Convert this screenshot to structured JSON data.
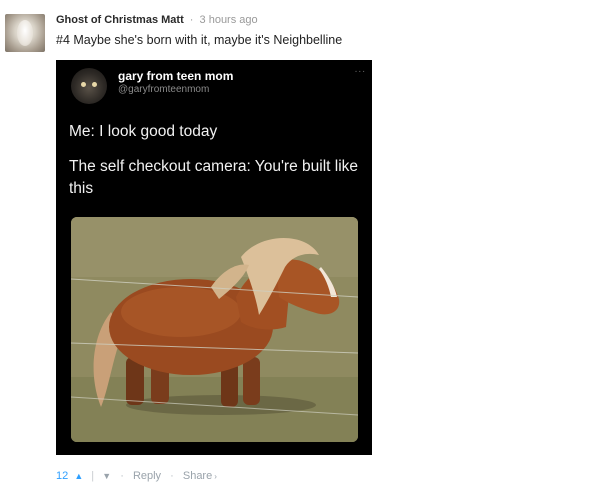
{
  "comment": {
    "username": "Ghost of Christmas Matt",
    "timestamp": "3 hours ago",
    "text": "#4 Maybe she's born with it, maybe it's Neighbelline"
  },
  "tweet": {
    "display_name": "gary from teen mom",
    "handle": "@garyfromteenmom",
    "more_icon": "...",
    "line1": "Me: I look good today",
    "line2": "The self checkout camera: You're built like this"
  },
  "actions": {
    "vote_count": "12",
    "reply_label": "Reply",
    "share_label": "Share"
  },
  "icons": {
    "upvote": "chevron-up-icon",
    "downvote": "chevron-down-icon",
    "share_caret": "caret-right-icon"
  },
  "colors": {
    "link_blue": "#2e9fff",
    "muted_gray": "#9aa3ab",
    "tweet_bg": "#000000"
  }
}
